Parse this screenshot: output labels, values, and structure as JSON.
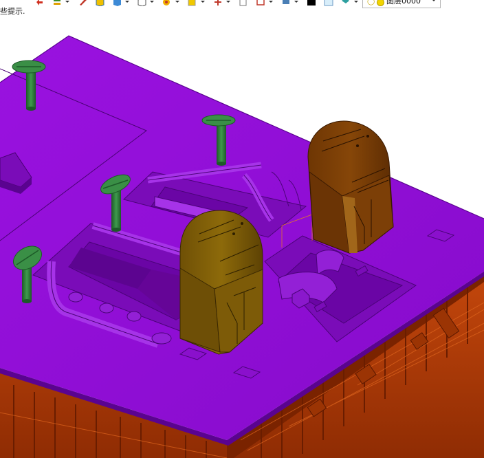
{
  "status_hint": "些提示.",
  "toolbar": {
    "icons": [
      "undo-icon",
      "layers-icon",
      "pen-icon",
      "cube-yellow-icon",
      "cube-blue-icon",
      "wireframe-cube-icon",
      "sketch-icon",
      "snap-icon",
      "point-icon",
      "page-icon",
      "rectangle-icon",
      "display-icon",
      "color-swatch-icon",
      "background-icon",
      "paint-bucket-icon"
    ],
    "layer_label": "图层0000"
  },
  "colors": {
    "plate": "#8f0ed4",
    "plate_dark": "#6a05a5",
    "plate_edge": "#5a0390",
    "frame": "#b13a07",
    "frame_dark": "#7f2502",
    "pin": "#2f7a3c",
    "block": "#856208",
    "block_dark": "#5b4104"
  }
}
